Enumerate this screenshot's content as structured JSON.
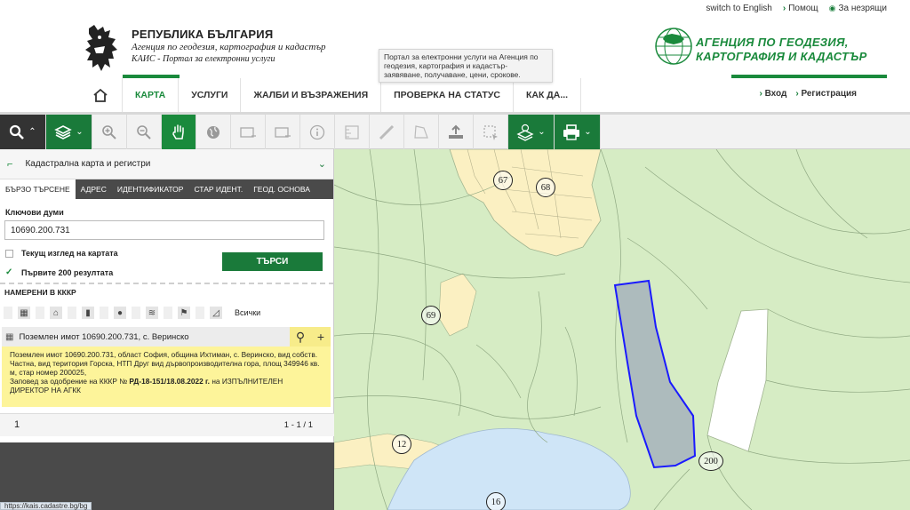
{
  "header": {
    "links": {
      "english": "switch to English",
      "help": "Помощ",
      "accessibility": "За незрящи"
    },
    "logo": {
      "line1": "РЕПУБЛИКА БЪЛГАРИЯ",
      "line2": "Агенция по геодезия, картография и кадастър",
      "line3": "КАИС - Портал за електронни услуги"
    },
    "tooltip": "Портал за електронни услуги на Агенция по геодезия, картография и кадастър- заявяване, получаване, цени, срокове.",
    "agency": {
      "line1": "АГЕНЦИЯ ПО ГЕОДЕЗИЯ,",
      "line2": "КАРТОГРАФИЯ И КАДАСТЪР"
    }
  },
  "nav": {
    "items": [
      "КАРТА",
      "УСЛУГИ",
      "ЖАЛБИ И ВЪЗРАЖЕНИЯ",
      "ПРОВЕРКА НА СТАТУС",
      "КАК ДА..."
    ],
    "login": "Вход",
    "register": "Регистрация"
  },
  "toolbar": {
    "icons": [
      "search-icon",
      "layers-icon",
      "zoom-in-icon",
      "zoom-out-icon",
      "pan-hand-icon",
      "globe-icon",
      "select-rect-icon",
      "deselect-icon",
      "info-icon",
      "ruler-icon",
      "measure-line-icon",
      "measure-area-icon",
      "upload-icon",
      "select-area-icon",
      "layer-info-icon",
      "print-icon"
    ]
  },
  "panel": {
    "layer": "Кадастрална карта и регистри",
    "tabs": [
      "БЪРЗО ТЪРСЕНЕ",
      "АДРЕС",
      "ИДЕНТИФИКАТОР",
      "СТАР ИДЕНТ.",
      "ГЕОД. ОСНОВА"
    ],
    "keywords_label": "Ключови думи",
    "keywords_value": "10690.200.731",
    "current_view": "Текущ изглед на картата",
    "first_200": "Първите 200 резултата",
    "search_button": "ТЪРСИ",
    "found_label": "НАМЕРЕНИ В КККР",
    "filter_all": "Всички",
    "result": {
      "title": "Поземлен имот 10690.200.731, с. Веринско",
      "desc": "Поземлен имот 10690.200.731, област София, община Ихтиман, с. Веринско, вид собств. Частна, вид територия Горска, НТП Друг вид дървопроизводителна гора, площ 349946 кв. м, стар номер 200025,",
      "order_prefix": "Заповед за одобрение на КККР №",
      "order_num": "РД-18-151/18.08.2022 г.",
      "order_suffix": "на ИЗПЪЛНИТЕЛЕН ДИРЕКТОР НА АГКК"
    },
    "pager": {
      "page": "1",
      "count": "1 - 1 / 1"
    }
  },
  "status_url": "https://kais.cadastre.bg/bg",
  "map": {
    "labels": [
      "67",
      "68",
      "69",
      "12",
      "200",
      "16"
    ],
    "colors": {
      "forest": "#d6ecc4",
      "settlement": "#fbf0c2",
      "water": "#cfe5f7",
      "selected": "#a9b6bd",
      "selected_stroke": "#1a1aff"
    }
  }
}
